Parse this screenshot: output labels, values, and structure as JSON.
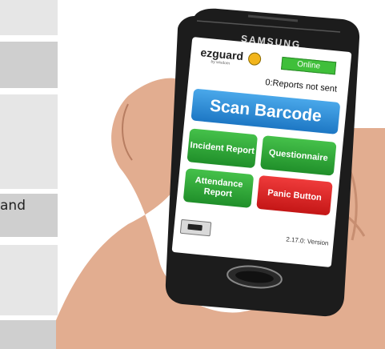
{
  "background": {
    "side_text": "and"
  },
  "phone": {
    "brand": "SAMSUNG",
    "app": {
      "logo": "ezguard",
      "logo_sub": "by wisdom",
      "status": "Online",
      "reports_status": "0:Reports not sent",
      "buttons": {
        "scan": "Scan Barcode",
        "incident": "Incident Report",
        "questionnaire": "Questionnaire",
        "attendance": "Attendance Report",
        "panic": "Panic Button"
      },
      "torch_icon": "flashlight-icon",
      "version": "2.17.0: Version"
    }
  },
  "colors": {
    "scan_button": "#2d8bd8",
    "green_button": "#2fa835",
    "panic_button": "#de2424",
    "online_badge": "#3fbf3a"
  }
}
